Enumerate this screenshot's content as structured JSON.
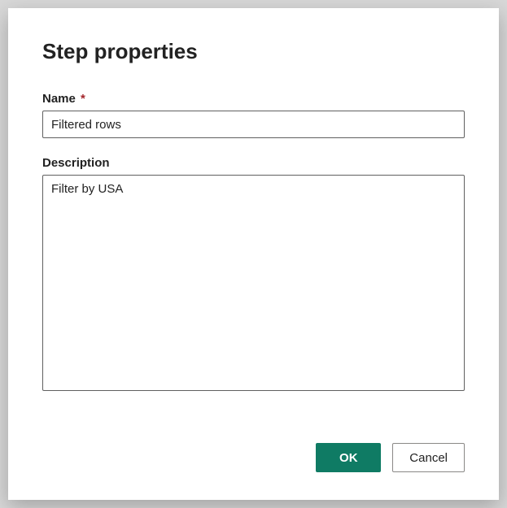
{
  "dialog": {
    "title": "Step properties",
    "name_field": {
      "label": "Name",
      "required_marker": "*",
      "value": "Filtered rows"
    },
    "description_field": {
      "label": "Description",
      "value": "Filter by USA"
    },
    "buttons": {
      "ok": "OK",
      "cancel": "Cancel"
    }
  }
}
